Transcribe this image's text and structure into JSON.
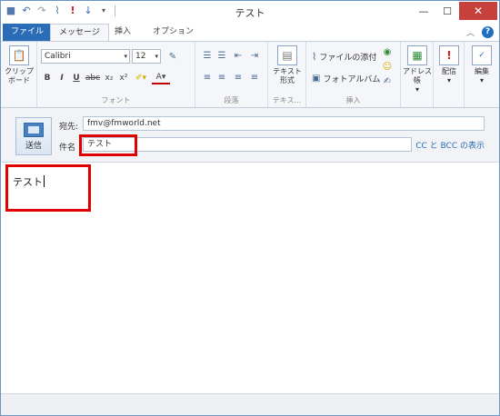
{
  "window": {
    "title": "テスト"
  },
  "quick_access": {
    "icons": [
      "save-icon",
      "undo-icon",
      "redo-icon",
      "attach-icon",
      "importance-icon",
      "down-arrow-icon",
      "customize-icon"
    ]
  },
  "tabs": [
    {
      "label": "ファイル"
    },
    {
      "label": "メッセージ"
    },
    {
      "label": "挿入"
    },
    {
      "label": "オプション"
    }
  ],
  "ribbon": {
    "clipboard": {
      "button": "クリップ\nボード",
      "group": ""
    },
    "font": {
      "family": "Calibri",
      "size": "12",
      "group": "フォント",
      "bold": "B",
      "italic": "I",
      "underline": "U",
      "strike": "abc",
      "sub": "x₂",
      "sup": "x²"
    },
    "paragraph": {
      "group": "段落"
    },
    "text": {
      "button": "テキスト\n形式",
      "group": "テキス..."
    },
    "insert": {
      "attach": "ファイルの添付",
      "album": "フォトアルバム",
      "group": "挿入"
    },
    "address": {
      "button": "アドレス帳"
    },
    "delivery": {
      "button": "配信"
    },
    "edit": {
      "button": "編集"
    }
  },
  "compose": {
    "send_label": "送信",
    "to_label": "宛先:",
    "to_value": "fmv@fmworld.net",
    "subject_label": "件名",
    "subject_value": "テスト",
    "cc_bcc_link": "CC と BCC の表示"
  },
  "body": {
    "text": "テスト"
  },
  "colors": {
    "file_tab": "#2b6cb6",
    "close_button": "#c7413c",
    "highlight": "#e00000",
    "link": "#2a6ab8"
  }
}
